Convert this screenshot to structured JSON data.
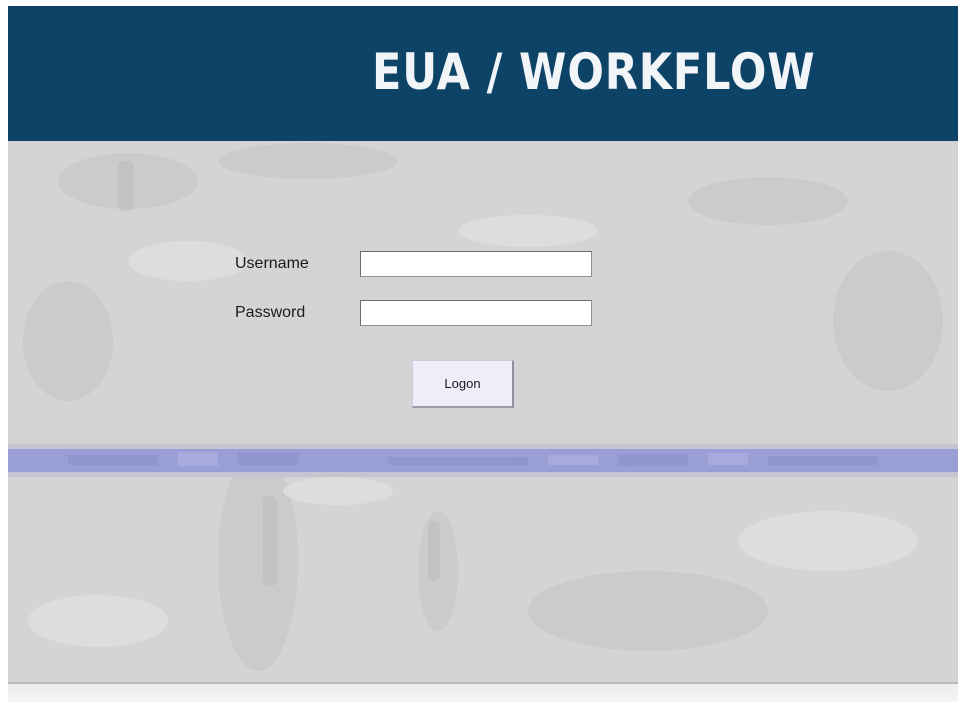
{
  "header": {
    "title": "EUA / WORKFLOW"
  },
  "form": {
    "username_label": "Username",
    "username_value": "",
    "password_label": "Password",
    "password_value": "",
    "logon_label": "Logon"
  },
  "colors": {
    "header_background": "#0d4367",
    "content_background": "#d4d4d6",
    "accent_stripe": "#9a9ed6",
    "button_background": "#eeeefb"
  }
}
